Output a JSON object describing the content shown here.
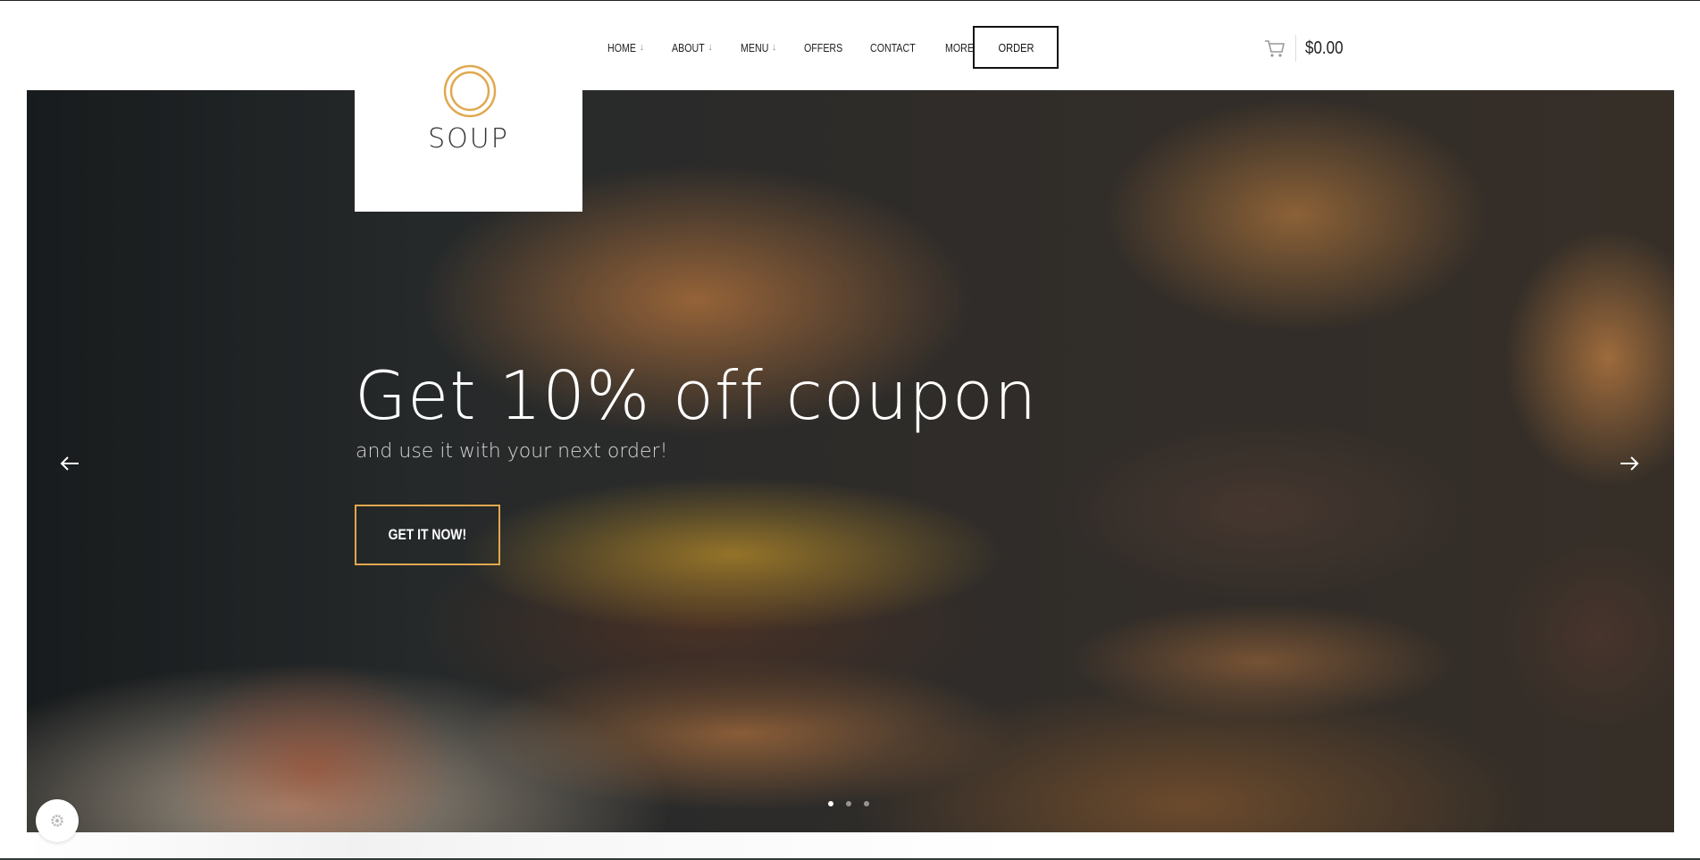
{
  "nav": {
    "items": [
      {
        "label": "HOME",
        "dropdown": true
      },
      {
        "label": "ABOUT",
        "dropdown": true
      },
      {
        "label": "MENU",
        "dropdown": true
      },
      {
        "label": "OFFERS",
        "dropdown": false
      },
      {
        "label": "CONTACT",
        "dropdown": false
      },
      {
        "label": "MORE",
        "dropdown": true
      }
    ],
    "order_label": "ORDER"
  },
  "cart": {
    "total": "$0.00",
    "icon": "cart-icon"
  },
  "logo": {
    "text": "SOUP",
    "accent": "#e1a84f"
  },
  "hero": {
    "title": "Get 10% off coupon",
    "subtitle": "and use it with your next order!",
    "cta_label": "GET IT NOW!",
    "cta_border": "#e1a84f",
    "slides": 3,
    "active_slide": 1
  },
  "icons": {
    "prev": "arrow-left-icon",
    "next": "arrow-right-icon",
    "settings": "gear-icon"
  }
}
